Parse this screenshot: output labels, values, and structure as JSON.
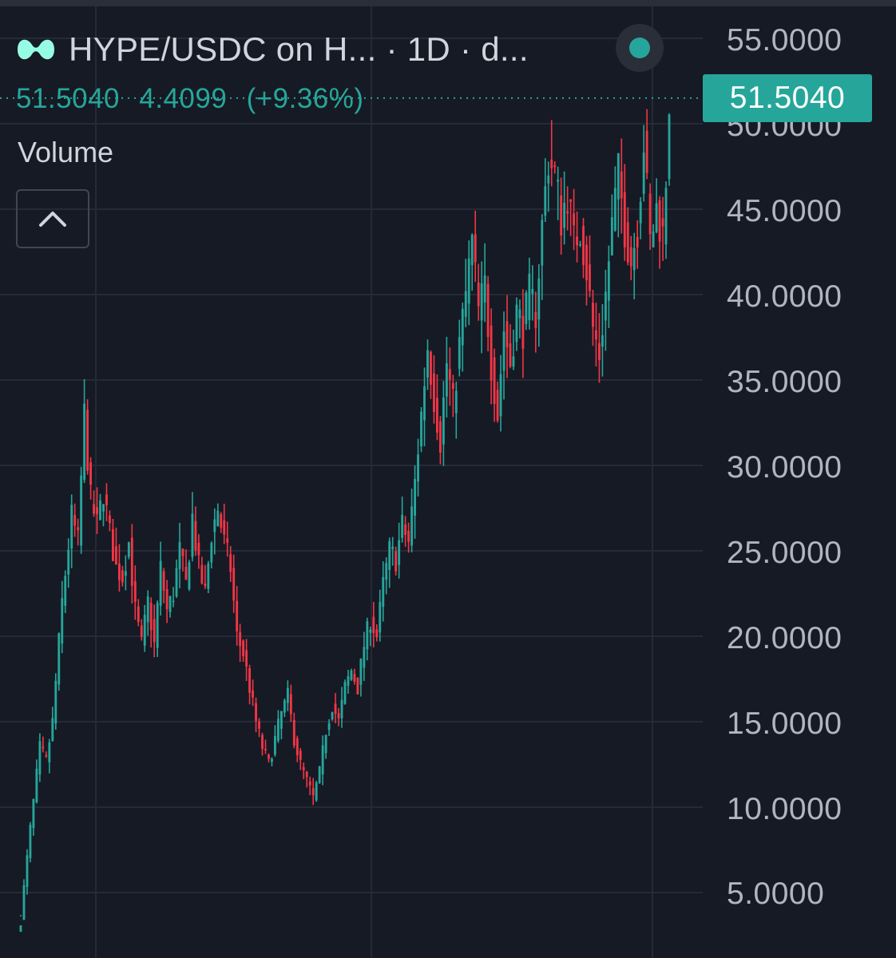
{
  "header": {
    "title": "HYPE/USDC on H...  · 1D · d...",
    "logo_icon": "hyperliquid-logo-icon",
    "status_icon": "live-status-dot-icon",
    "collapse_icon": "chevron-up-icon"
  },
  "quote": {
    "last": "51.5040",
    "change": "4.4099",
    "change_pct": "(+9.36%)"
  },
  "indicators": {
    "volume_label": "Volume"
  },
  "price_axis": {
    "ticks": [
      "55.0000",
      "50.0000",
      "45.0000",
      "40.0000",
      "35.0000",
      "30.0000",
      "25.0000",
      "20.0000",
      "15.0000",
      "10.0000",
      "5.0000"
    ],
    "current_price_label": "51.5040"
  },
  "colors": {
    "background": "#161a25",
    "up": "#26a69a",
    "down": "#f23645",
    "grid": "#262a36",
    "axis_text": "#b2b5be"
  },
  "chart_data": {
    "type": "candlestick",
    "timeframe": "1D",
    "ylim": [
      3.5,
      56.5
    ],
    "current_price": 51.504,
    "close_path": [
      [
        0,
        3.5
      ],
      [
        3,
        8.7
      ],
      [
        6,
        13.5
      ],
      [
        8,
        12.7
      ],
      [
        10,
        15
      ],
      [
        13,
        22
      ],
      [
        16,
        27
      ],
      [
        18,
        25.5
      ],
      [
        20,
        33
      ],
      [
        22,
        28
      ],
      [
        24,
        26.5
      ],
      [
        26,
        28.5
      ],
      [
        28,
        26
      ],
      [
        30,
        24
      ],
      [
        32,
        23.5
      ],
      [
        34,
        25.5
      ],
      [
        36,
        21.5
      ],
      [
        38,
        19.5
      ],
      [
        40,
        22
      ],
      [
        42,
        19.5
      ],
      [
        44,
        24
      ],
      [
        46,
        21.5
      ],
      [
        48,
        22.5
      ],
      [
        50,
        25
      ],
      [
        52,
        23
      ],
      [
        54,
        27
      ],
      [
        56,
        24
      ],
      [
        58,
        22.5
      ],
      [
        60,
        26
      ],
      [
        62,
        27.5
      ],
      [
        64,
        25.5
      ],
      [
        66,
        24
      ],
      [
        68,
        20
      ],
      [
        70,
        19
      ],
      [
        72,
        17
      ],
      [
        74,
        15
      ],
      [
        76,
        13.5
      ],
      [
        78,
        12.5
      ],
      [
        80,
        14
      ],
      [
        82,
        15.5
      ],
      [
        84,
        16.5
      ],
      [
        86,
        14
      ],
      [
        88,
        12.5
      ],
      [
        90,
        11.5
      ],
      [
        92,
        10.5
      ],
      [
        94,
        12
      ],
      [
        96,
        14.5
      ],
      [
        98,
        16
      ],
      [
        100,
        15
      ],
      [
        102,
        17
      ],
      [
        104,
        18
      ],
      [
        106,
        17
      ],
      [
        108,
        19.5
      ],
      [
        110,
        21
      ],
      [
        112,
        20
      ],
      [
        114,
        23
      ],
      [
        116,
        25
      ],
      [
        118,
        24.5
      ],
      [
        120,
        26.5
      ],
      [
        122,
        25.5
      ],
      [
        124,
        29
      ],
      [
        126,
        33
      ],
      [
        128,
        37
      ],
      [
        130,
        34
      ],
      [
        132,
        31.5
      ],
      [
        134,
        36
      ],
      [
        136,
        33.5
      ],
      [
        138,
        37
      ],
      [
        140,
        40
      ],
      [
        142,
        43
      ],
      [
        144,
        39
      ],
      [
        146,
        40.5
      ],
      [
        148,
        36
      ],
      [
        150,
        33
      ],
      [
        152,
        38
      ],
      [
        154,
        36
      ],
      [
        156,
        39
      ],
      [
        158,
        38
      ],
      [
        160,
        40
      ],
      [
        162,
        39
      ],
      [
        164,
        44
      ],
      [
        166,
        48
      ],
      [
        168,
        47
      ],
      [
        170,
        44.5
      ],
      [
        172,
        46
      ],
      [
        174,
        43
      ],
      [
        176,
        44
      ],
      [
        178,
        41.5
      ],
      [
        180,
        38
      ],
      [
        182,
        36.5
      ],
      [
        184,
        40
      ],
      [
        186,
        44
      ],
      [
        188,
        47
      ],
      [
        190,
        44
      ],
      [
        192,
        42
      ],
      [
        194,
        44
      ],
      [
        196,
        49
      ],
      [
        198,
        43
      ],
      [
        200,
        45
      ],
      [
        202,
        43.5
      ],
      [
        203,
        47
      ],
      [
        204,
        51.5
      ]
    ]
  }
}
